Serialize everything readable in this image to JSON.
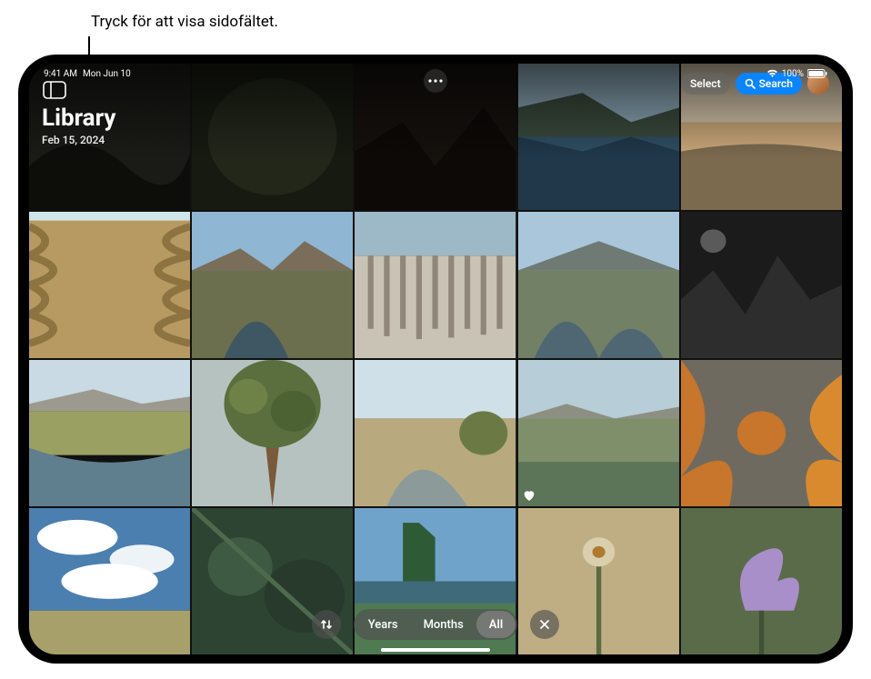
{
  "callout": {
    "text": "Tryck för att visa sidofältet."
  },
  "status": {
    "time": "9:41 AM",
    "date": "Mon Jun 10",
    "battery": "100%"
  },
  "header": {
    "title": "Library",
    "subtitle": "Feb 15, 2024",
    "select_label": "Select",
    "search_label": "Search"
  },
  "segments": {
    "years": "Years",
    "months": "Months",
    "all": "All",
    "selected": "all"
  },
  "grid": {
    "rows": 4,
    "cols": 5,
    "cells": [
      {
        "name": "dark-tree-shade",
        "favorite": false
      },
      {
        "name": "dark-foliage",
        "favorite": false
      },
      {
        "name": "dark-rocks",
        "favorite": false
      },
      {
        "name": "river-reflection",
        "favorite": false
      },
      {
        "name": "beach-sunset",
        "favorite": false
      },
      {
        "name": "sand-ripples",
        "favorite": false
      },
      {
        "name": "canyon-stream",
        "favorite": false
      },
      {
        "name": "rock-columns",
        "favorite": false
      },
      {
        "name": "mountain-stream",
        "favorite": false
      },
      {
        "name": "dark-volcanic-rocks",
        "favorite": false
      },
      {
        "name": "plain-river",
        "favorite": false
      },
      {
        "name": "juniper-tree",
        "favorite": false
      },
      {
        "name": "desert-creek",
        "favorite": false
      },
      {
        "name": "riverbank-grass",
        "favorite": true
      },
      {
        "name": "orange-lichen-rock",
        "favorite": false
      },
      {
        "name": "clouds-prairie",
        "favorite": false
      },
      {
        "name": "underwater-pond",
        "favorite": false
      },
      {
        "name": "tree-and-lake",
        "favorite": false
      },
      {
        "name": "single-flower",
        "favorite": false
      },
      {
        "name": "purple-sweetpea",
        "favorite": false
      }
    ]
  }
}
